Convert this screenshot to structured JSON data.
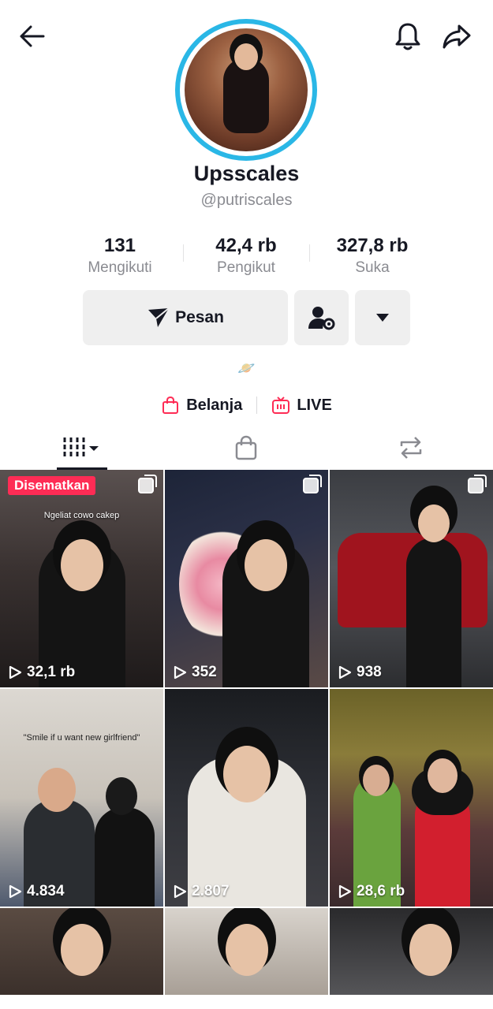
{
  "profile": {
    "display_name": "Upsscales",
    "handle": "@putriscales",
    "planet": "🪐"
  },
  "stats": [
    {
      "value": "131",
      "label": "Mengikuti"
    },
    {
      "value": "42,4 rb",
      "label": "Pengikut"
    },
    {
      "value": "327,8 rb",
      "label": "Suka"
    }
  ],
  "actions": {
    "message_label": "Pesan"
  },
  "links": {
    "shop_label": "Belanja",
    "live_label": "LIVE"
  },
  "colors": {
    "accent": "#fe2c55",
    "avatar_ring": "#2ab7e6",
    "text": "#161823",
    "secondary_text": "#8a8b91"
  },
  "videos": [
    {
      "views": "32,1 rb",
      "pinned_label": "Disematkan",
      "caption": "Ngeliat cowo cakep",
      "multi": true
    },
    {
      "views": "352",
      "multi": true
    },
    {
      "views": "938",
      "multi": true
    },
    {
      "views": "4.834",
      "caption": "\"Smile if u want new girlfriend\""
    },
    {
      "views": "2.807"
    },
    {
      "views": "28,6 rb"
    }
  ]
}
